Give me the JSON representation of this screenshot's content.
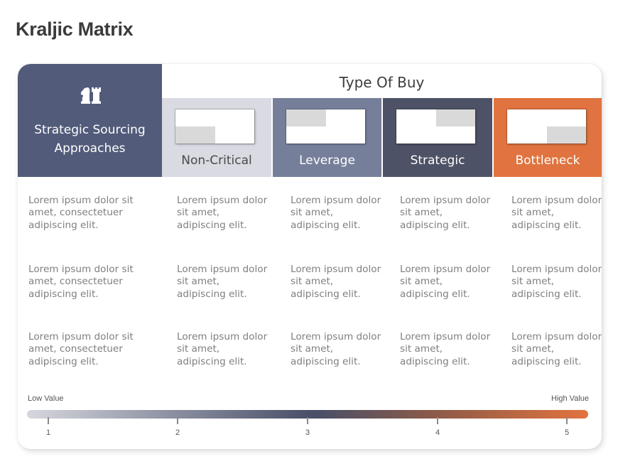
{
  "title": "Kraljic Matrix",
  "corner": {
    "icon": "chess-pieces-icon",
    "label": "Strategic Sourcing Approaches"
  },
  "header": {
    "title": "Type Of Buy"
  },
  "columns": [
    {
      "label": "Non-Critical",
      "highlight_quadrant": "bottom-left",
      "bg": "#d9dae2",
      "fg": "#4a4a4a"
    },
    {
      "label": "Leverage",
      "highlight_quadrant": "top-left",
      "bg": "#767f9a",
      "fg": "#ffffff"
    },
    {
      "label": "Strategic",
      "highlight_quadrant": "top-right",
      "bg": "#4d5266",
      "fg": "#ffffff"
    },
    {
      "label": "Bottleneck",
      "highlight_quadrant": "bottom-right",
      "bg": "#e0733f",
      "fg": "#ffffff"
    }
  ],
  "rows": [
    {
      "approach": "Lorem ipsum dolor sit amet, consectetuer adipiscing elit.",
      "cells": [
        "Lorem ipsum dolor sit amet, adipiscing elit.",
        "Lorem ipsum dolor sit amet, adipiscing elit.",
        "Lorem ipsum dolor sit amet, adipiscing elit.",
        "Lorem ipsum dolor sit amet, adipiscing elit."
      ]
    },
    {
      "approach": "Lorem ipsum dolor sit amet, consectetuer adipiscing elit.",
      "cells": [
        "Lorem ipsum dolor sit amet, adipiscing elit.",
        "Lorem ipsum dolor sit amet, adipiscing elit.",
        "Lorem ipsum dolor sit amet, adipiscing elit.",
        "Lorem ipsum dolor sit amet, adipiscing elit."
      ]
    },
    {
      "approach": "Lorem ipsum dolor sit amet, consectetuer adipiscing elit.",
      "cells": [
        "Lorem ipsum dolor sit amet, adipiscing elit.",
        "Lorem ipsum dolor sit amet, adipiscing elit.",
        "Lorem ipsum dolor sit amet, adipiscing elit.",
        "Lorem ipsum dolor sit amet, adipiscing elit."
      ]
    }
  ],
  "scale": {
    "low_label": "Low Value",
    "high_label": "High Value",
    "ticks": [
      "1",
      "2",
      "3",
      "4",
      "5"
    ],
    "colors": {
      "low": "#d6d7de",
      "mid": "#4a5068",
      "high": "#e2733f"
    }
  }
}
